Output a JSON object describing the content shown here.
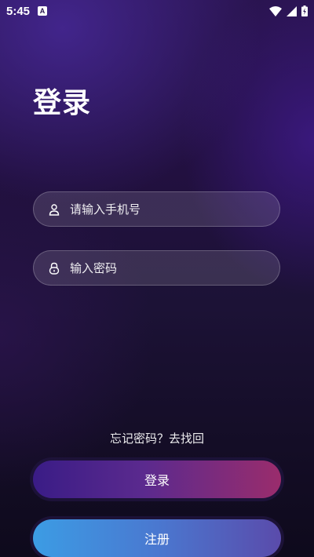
{
  "status": {
    "time": "5:45",
    "notification_letter": "A"
  },
  "page": {
    "title": "登录"
  },
  "phone": {
    "placeholder": "请输入手机号",
    "icon": "user-icon"
  },
  "password": {
    "placeholder": "输入密码",
    "icon": "lock-icon"
  },
  "forgot": {
    "label": "忘记密码？去找回"
  },
  "buttons": {
    "login_label": "登录",
    "register_label": "注册"
  },
  "colors": {
    "login_gradient_start": "#3a1c86",
    "login_gradient_end": "#9a2c6c",
    "register_gradient_start": "#3c9ce4",
    "register_gradient_end": "#5a4bab"
  }
}
